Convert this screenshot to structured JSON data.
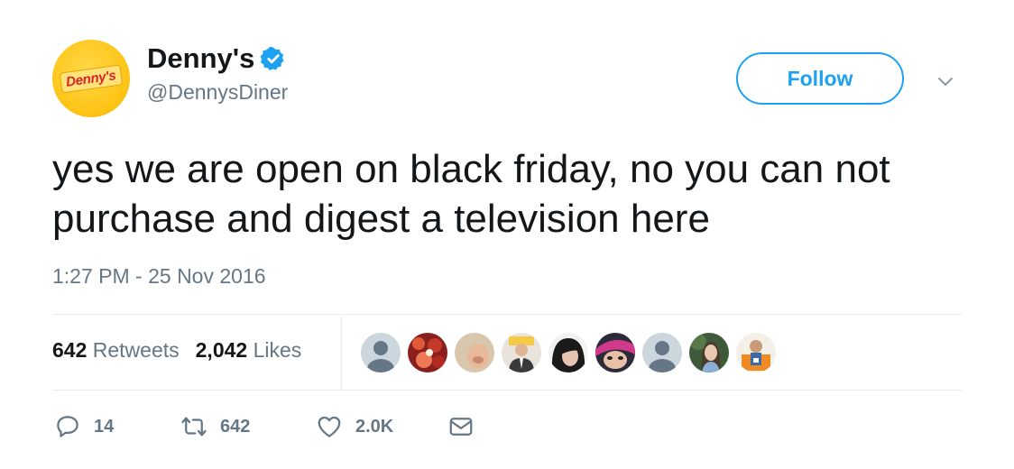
{
  "author": {
    "avatar_logo_text": "Denny's",
    "display_name": "Denny's",
    "handle": "@DennysDiner",
    "verified": true
  },
  "follow_label": "Follow",
  "tweet": {
    "text": "yes we are open on black friday, no you can not purchase and digest a television here",
    "timestamp": "1:27 PM - 25 Nov 2016"
  },
  "stats": {
    "retweets_count": "642",
    "retweets_label": "Retweets",
    "likes_count": "2,042",
    "likes_label": "Likes"
  },
  "likers": [
    {
      "kind": "default"
    },
    {
      "kind": "red-pattern"
    },
    {
      "kind": "beige-face"
    },
    {
      "kind": "suit"
    },
    {
      "kind": "dark-hair"
    },
    {
      "kind": "pink-hair"
    },
    {
      "kind": "default"
    },
    {
      "kind": "green-photo"
    },
    {
      "kind": "orange-figure"
    }
  ],
  "actions": {
    "reply_count": "14",
    "retweet_count": "642",
    "like_count": "2.0K"
  },
  "colors": {
    "accent": "#1da1f2",
    "muted": "#657786",
    "text": "#14171a",
    "brand_yellow": "#ffc61a",
    "brand_red": "#d8232a"
  },
  "icons": [
    "verified-badge-icon",
    "chevron-down-icon",
    "reply-icon",
    "retweet-icon",
    "heart-icon",
    "direct-message-icon"
  ]
}
